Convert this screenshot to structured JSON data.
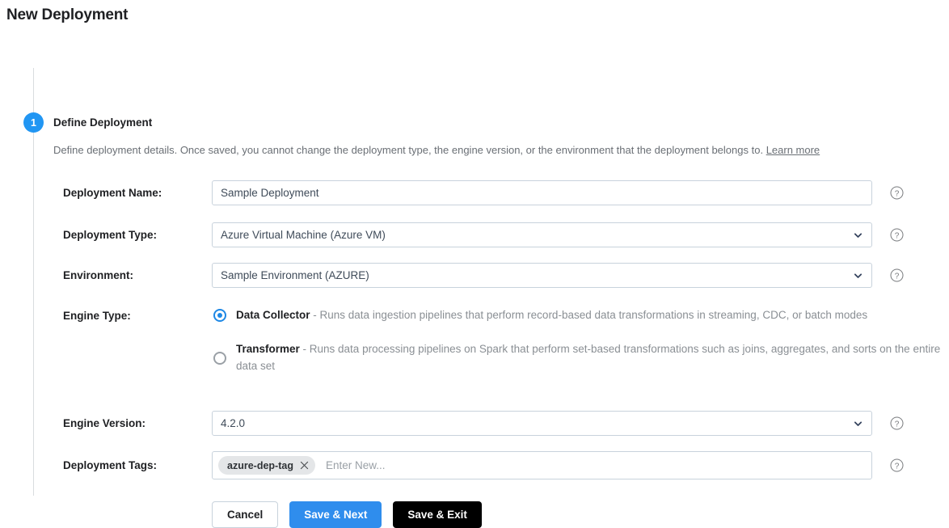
{
  "page": {
    "title": "New Deployment"
  },
  "step": {
    "number": "1",
    "title": "Define Deployment",
    "description": "Define deployment details. Once saved, you cannot change the deployment type, the engine version, or the environment that the deployment belongs to.",
    "learn_more": "Learn more"
  },
  "form": {
    "deployment_name": {
      "label": "Deployment Name:",
      "value": "Sample Deployment"
    },
    "deployment_type": {
      "label": "Deployment Type:",
      "value": "Azure Virtual Machine (Azure VM)"
    },
    "environment": {
      "label": "Environment:",
      "value": "Sample Environment (AZURE)"
    },
    "engine_type": {
      "label": "Engine Type:",
      "options": [
        {
          "name": "Data Collector",
          "description": " - Runs data ingestion pipelines that perform record-based data transformations in streaming, CDC, or batch modes",
          "selected": true
        },
        {
          "name": "Transformer",
          "description": " - Runs data processing pipelines on Spark that perform set-based transformations such as joins, aggregates, and sorts on the entire data set",
          "selected": false
        }
      ]
    },
    "engine_version": {
      "label": "Engine Version:",
      "value": "4.2.0"
    },
    "deployment_tags": {
      "label": "Deployment Tags:",
      "tags": [
        "azure-dep-tag"
      ],
      "placeholder": "Enter New..."
    }
  },
  "buttons": {
    "cancel": "Cancel",
    "save_next": "Save & Next",
    "save_exit": "Save & Exit"
  },
  "colors": {
    "accent_blue": "#2196f3",
    "primary_button": "#2f8ded",
    "secondary_button": "#000000",
    "label_text": "#1f2023",
    "muted_text": "#6a6f75"
  }
}
